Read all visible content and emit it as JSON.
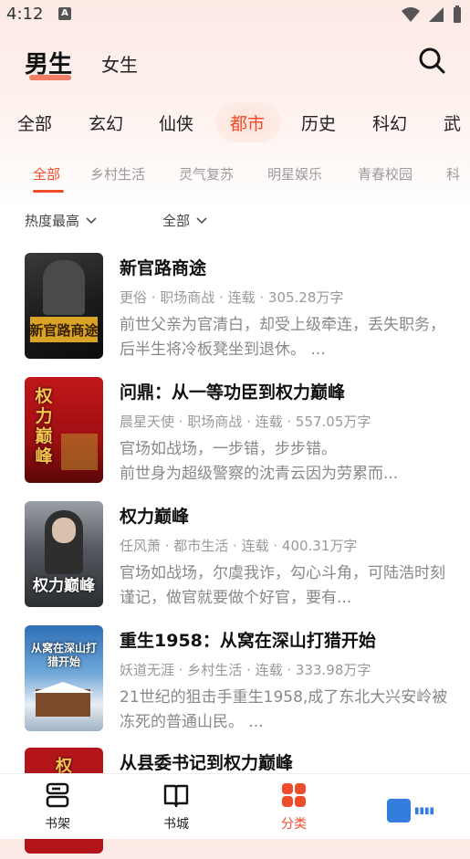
{
  "status": {
    "time": "4:12",
    "badge": "A"
  },
  "header": {
    "gender_active": "男生",
    "gender_other": "女生"
  },
  "categories": [
    "全部",
    "玄幻",
    "仙侠",
    "都市",
    "历史",
    "科幻",
    "武"
  ],
  "subcategories": [
    "全部",
    "乡村生活",
    "灵气复苏",
    "明星娱乐",
    "青春校园",
    "科"
  ],
  "filters": {
    "sort": "热度最高",
    "status": "全部"
  },
  "books": [
    {
      "title": "新官路商途",
      "meta": "更俗 · 职场商战 · 连载 · 305.28万字",
      "desc": "前世父亲为官清白，却受上级牵连，丢失职务，后半生将冷板凳坐到退休。 ...",
      "cover_text": "新官路商途"
    },
    {
      "title": "问鼎：从一等功臣到权力巅峰",
      "meta": "晨星天使 · 职场商战 · 连载 · 557.05万字",
      "desc": "官场如战场，一步错，步步错。\n前世身为超级警察的沈青云因为劳累而...",
      "cover_text": "权力巅峰"
    },
    {
      "title": "权力巅峰",
      "meta": "任风萧 · 都市生活 · 连载 · 400.31万字",
      "desc": "官场如战场，尔虞我诈，勾心斗角，可陆浩时刻谨记，做官就要做个好官，要有...",
      "cover_text": "权力巅峰"
    },
    {
      "title": "重生1958：从窝在深山打猎开始",
      "meta": "妖道无涯 · 乡村生活 · 连载 · 333.98万字",
      "desc": "21世纪的狙击手重生1958,成了东北大兴安岭被冻死的普通山民。 ...",
      "cover_text": "从窝在深山打猎开始"
    },
    {
      "title": "从县委书记到权力巅峰",
      "meta": "",
      "desc": "",
      "cover_text": "权"
    }
  ],
  "nav": {
    "shelf": "书架",
    "city": "书城",
    "category": "分类"
  },
  "colors": {
    "accent": "#ef4c2b"
  }
}
